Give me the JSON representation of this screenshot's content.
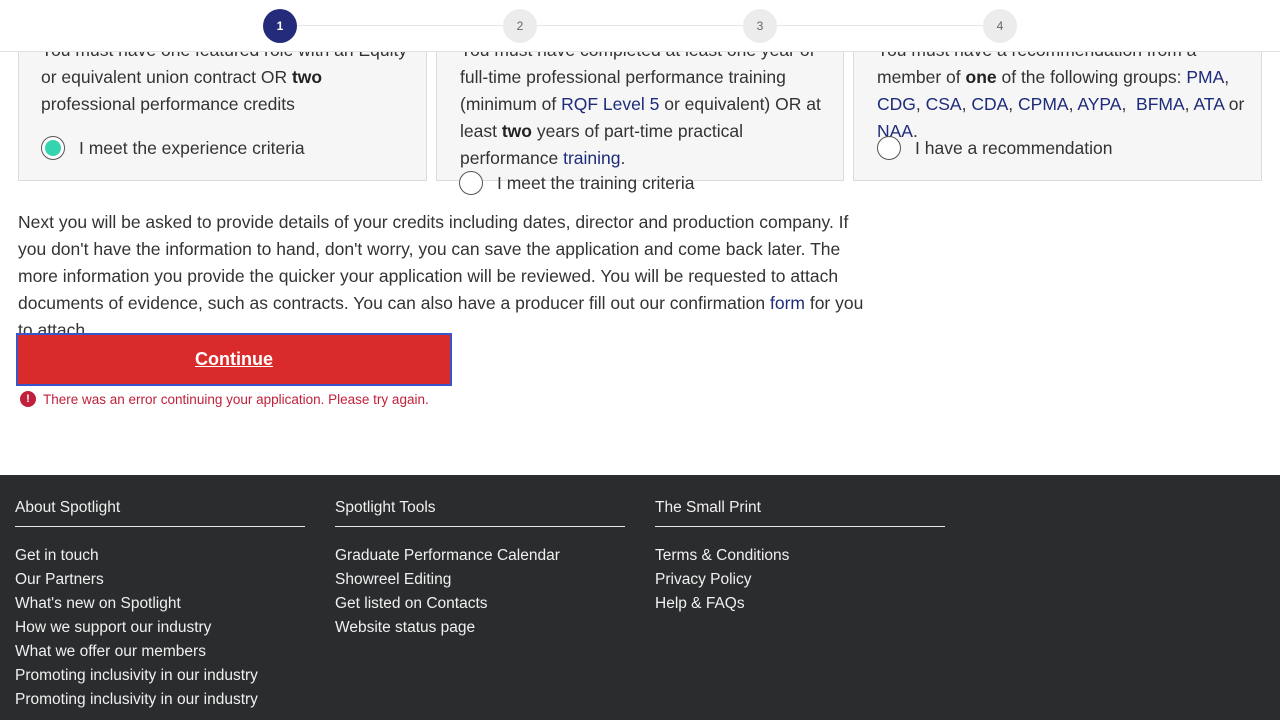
{
  "stepper": {
    "steps": [
      "1",
      "2",
      "3",
      "4"
    ],
    "active_step": 1
  },
  "cards": [
    {
      "line1": "You must have one featured role with an Equity",
      "line2_pre": "or equivalent union contract OR ",
      "line2_bold": "two",
      "line3": "professional performance credits",
      "radio_label": "I meet the experience criteria",
      "selected": true
    },
    {
      "line1": "You must have completed at least one year of",
      "line2": "full-time professional performance training",
      "line3_pre": "(minimum of ",
      "line3_link": "RQF Level 5",
      "line3_post": " or equivalent) OR at",
      "line4_pre": "least ",
      "line4_bold": "two",
      "line4_post": " years of part-time practical",
      "line5_pre": "performance ",
      "line5_link": "training",
      "line5_post": ".",
      "radio_label": "I meet the training criteria",
      "selected": false
    },
    {
      "line1": "You must have a recommendation from a",
      "line2_pre": "member of ",
      "line2_bold": "one",
      "line2_post": " of the following groups: ",
      "groups": [
        "PMA",
        "CDG",
        "CSA",
        "CDA",
        "CPMA",
        "AYPA",
        "BFMA",
        "ATA",
        "NAA"
      ],
      "or_text": "or",
      "radio_label": "I have a recommendation",
      "selected": false
    }
  ],
  "info": {
    "text": "Next you will be asked to provide details of your credits including dates, director and production company. If you don't have the information to hand, don't worry, you can save the application and come back later. The more information you provide the quicker your application will be reviewed. You will be requested to attach documents of evidence, such as contracts. You can also have a producer fill out our confirmation ",
    "link": "form",
    "tail": " for you to attach."
  },
  "continue_label": "Continue",
  "error_icon": "!",
  "error_text": "There was an error continuing your application. Please try again.",
  "footer": {
    "col1": {
      "title": "About Spotlight",
      "items": [
        "Get in touch",
        "Our Partners",
        "What's new on Spotlight",
        "How we support our industry",
        "What we offer our members",
        "Promoting inclusivity in our industry",
        "Promoting inclusivity in our industry"
      ]
    },
    "col2": {
      "title": "Spotlight Tools",
      "items": [
        "Graduate Performance Calendar",
        "Showreel Editing",
        "Get listed on Contacts",
        "Website status page"
      ]
    },
    "col3": {
      "title": "The Small Print",
      "items": [
        "Terms & Conditions",
        "Privacy Policy",
        "Help & FAQs"
      ]
    }
  },
  "colors": {
    "accent": "#232b7a",
    "button": "#d92b2b",
    "error": "#c0203a",
    "radio_selected": "#35d4b0",
    "footer_bg": "#2b2c2e"
  }
}
